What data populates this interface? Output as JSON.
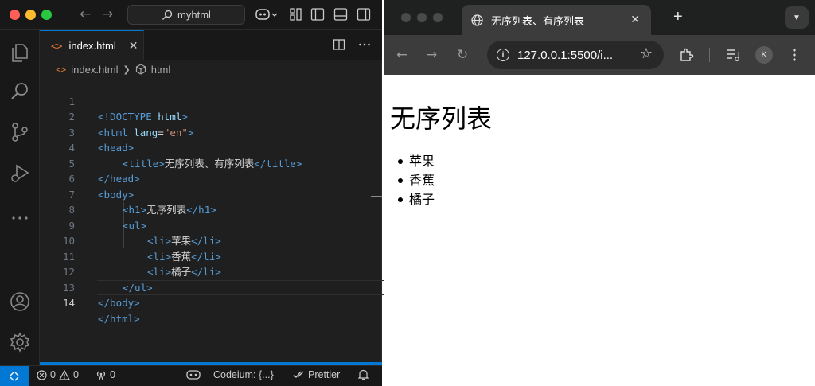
{
  "vscode": {
    "title_search": "myhtml",
    "tab": {
      "label": "index.html"
    },
    "breadcrumb": {
      "file": "index.html",
      "symbol": "html"
    },
    "code_lines": [
      {
        "num": "1"
      },
      {
        "num": "2"
      },
      {
        "num": "3"
      },
      {
        "num": "4"
      },
      {
        "num": "5"
      },
      {
        "num": "6"
      },
      {
        "num": "7"
      },
      {
        "num": "8"
      },
      {
        "num": "9"
      },
      {
        "num": "10"
      },
      {
        "num": "11"
      },
      {
        "num": "12"
      },
      {
        "num": "13"
      },
      {
        "num": "14"
      }
    ],
    "code": {
      "l1_doctype": "<!DOCTYPE",
      "l1_html": "html",
      "l1_end": ">",
      "l2_open": "<html",
      "l2_attr": "lang",
      "l2_eq": "=",
      "l2_val": "\"en\"",
      "l2_end": ">",
      "l3": "<head>",
      "l4_open": "<title>",
      "l4_text": "无序列表、有序列表",
      "l4_close": "</title>",
      "l5": "</head>",
      "l6": "<body>",
      "l7_open": "<h1>",
      "l7_text": "无序列表",
      "l7_close": "</h1>",
      "l8": "<ul>",
      "li_open": "<li>",
      "li_close": "</li>",
      "l9_text": "苹果",
      "l10_text": "香蕉",
      "l11_text": "橘子",
      "l12": "</ul>",
      "l13": "</body>",
      "l14": "</html>"
    },
    "status": {
      "errors": "0",
      "warnings": "0",
      "ports": "0",
      "codeium": "Codeium: {...}",
      "prettier": "Prettier"
    }
  },
  "browser": {
    "tab_title": "无序列表、有序列表",
    "url": "127.0.0.1:5500/i...",
    "avatar_letter": "K",
    "page": {
      "heading": "无序列表",
      "items": [
        "苹果",
        "香蕉",
        "橘子"
      ]
    }
  },
  "colors": {
    "accent": "#0078d4",
    "traffic_red": "#ff5f57",
    "traffic_yellow": "#febc2e",
    "traffic_green": "#28c840"
  }
}
